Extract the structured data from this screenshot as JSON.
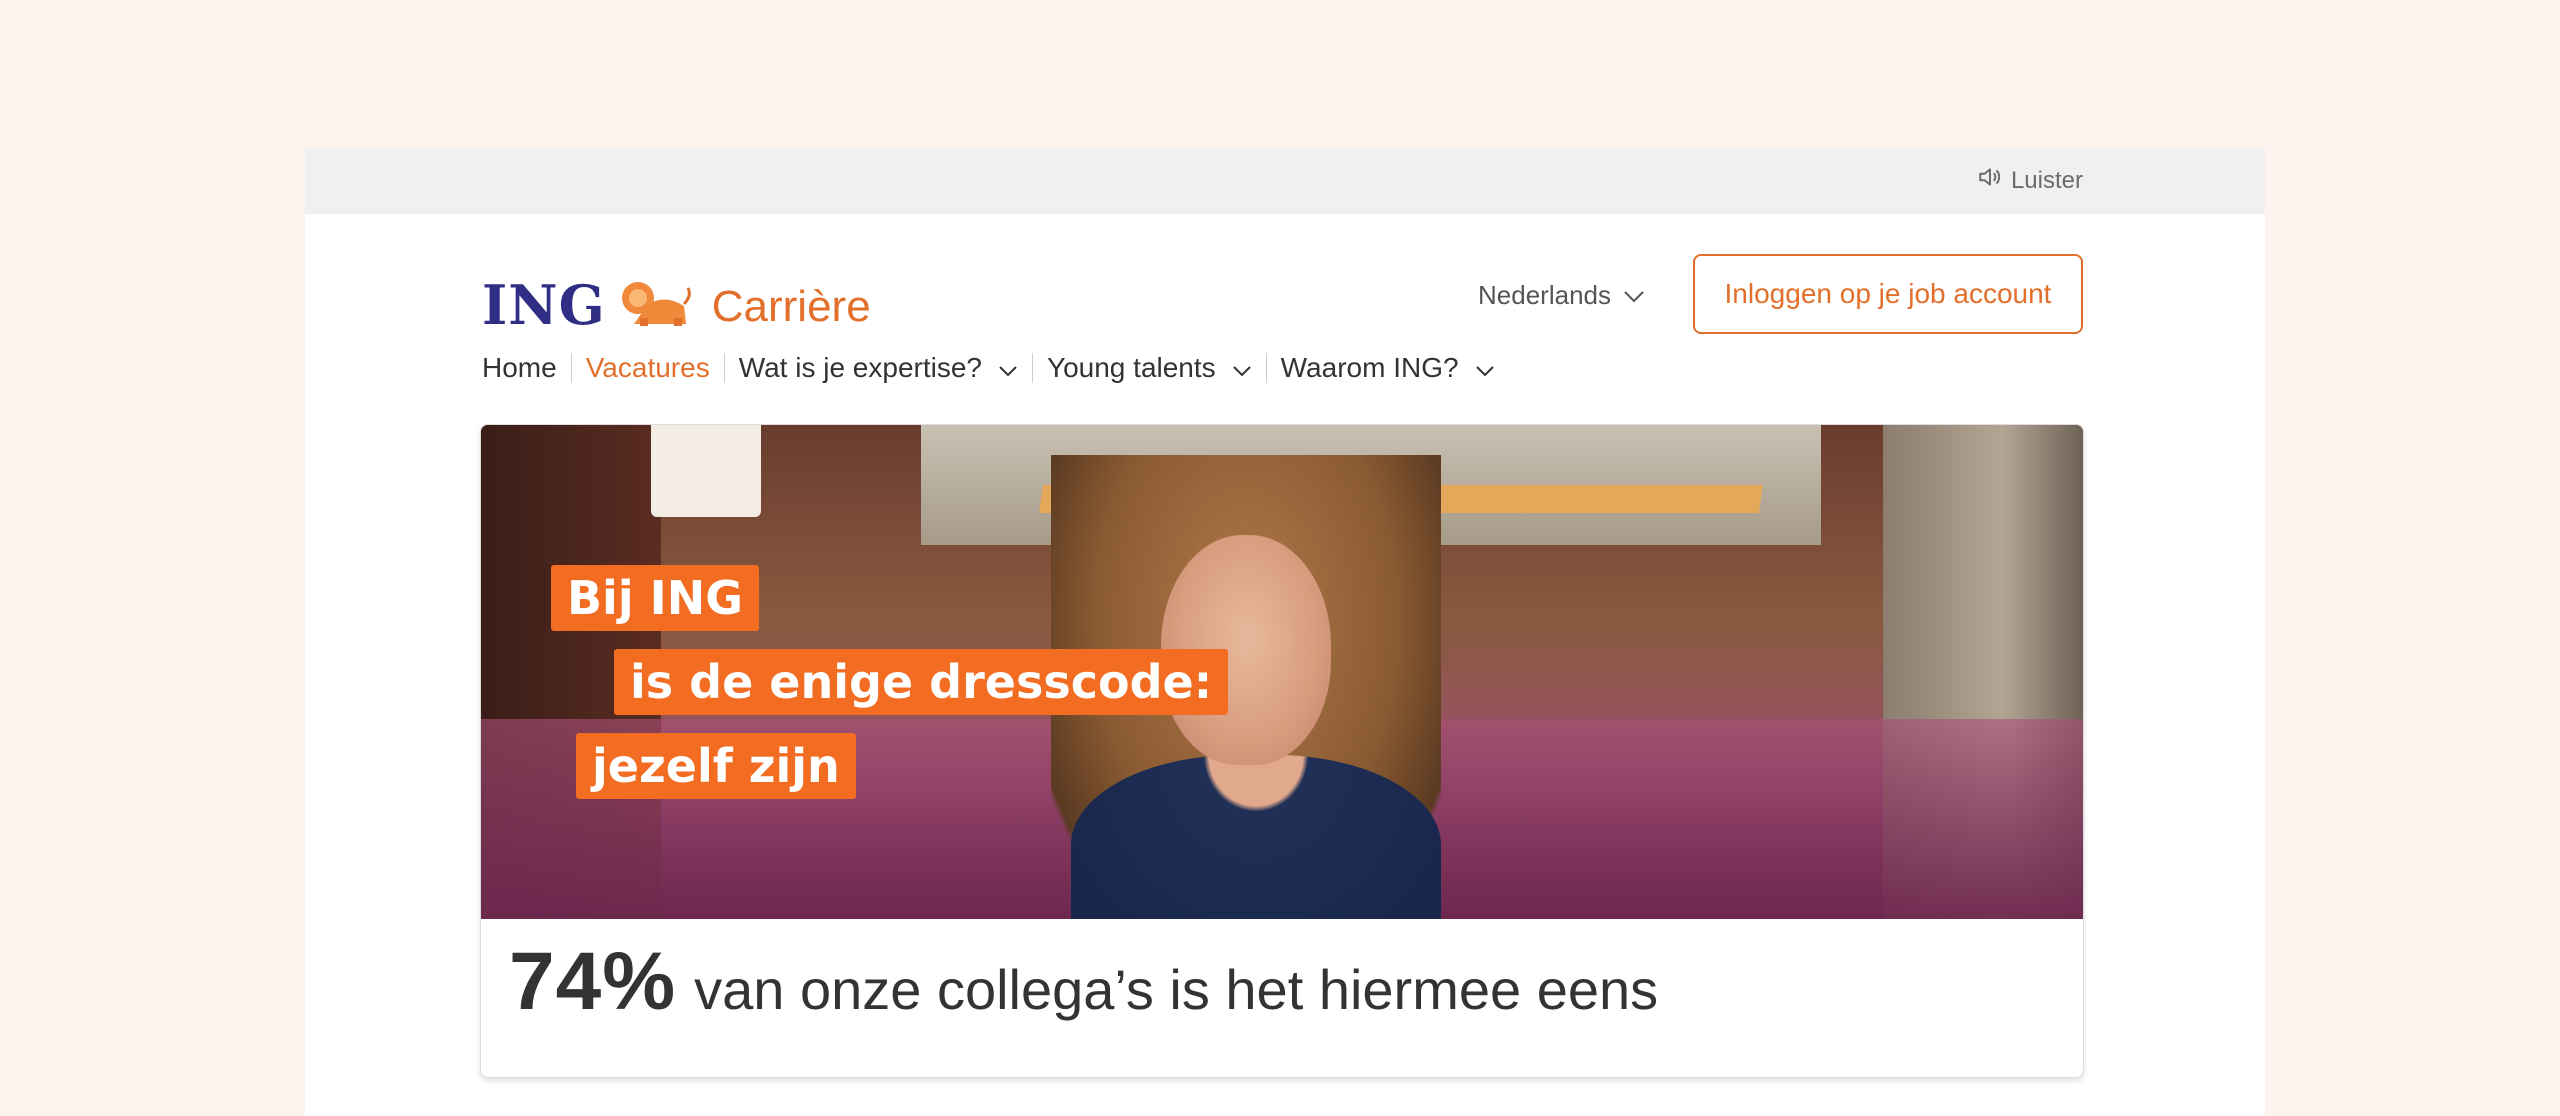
{
  "topbar": {
    "listen_label": "Luister",
    "listen_icon": "speaker-icon"
  },
  "header": {
    "logo_text": "ING",
    "logo_sub": "Carrière",
    "language_label": "Nederlands",
    "login_label": "Inloggen op je job account"
  },
  "nav": {
    "items": [
      {
        "label": "Home",
        "dropdown": false
      },
      {
        "label": "Vacatures",
        "dropdown": false,
        "active": true
      },
      {
        "label": "Wat is je expertise?",
        "dropdown": true
      },
      {
        "label": "Young talents",
        "dropdown": true
      },
      {
        "label": "Waarom ING?",
        "dropdown": true
      }
    ]
  },
  "hero": {
    "line1": "Bij ING",
    "line2": "is de enige dresscode:",
    "line3": "jezelf zijn"
  },
  "stat": {
    "value": "74%",
    "text": "van onze collega’s is het hiermee eens"
  },
  "colors": {
    "accent": "#e2702c",
    "brand_blue": "#2f2d84",
    "tag_orange": "#f26c22"
  }
}
